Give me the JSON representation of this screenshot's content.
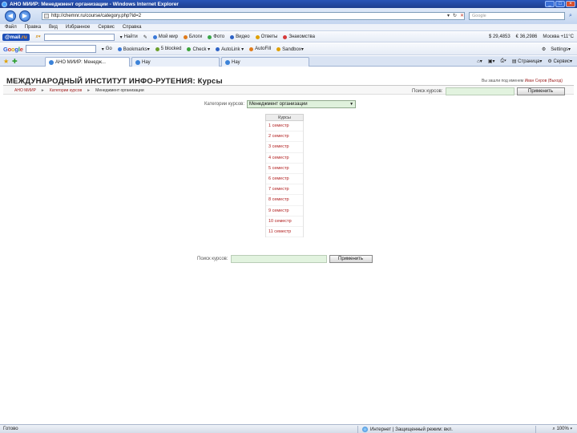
{
  "window": {
    "title": "АНО МИИР: Менеджмент организации - Windows Internet Explorer"
  },
  "address": {
    "url": "http://chemnr.ru/course/category.php?id=2",
    "search_placeholder": "Google"
  },
  "menu": [
    "Файл",
    "Правка",
    "Вид",
    "Избранное",
    "Сервис",
    "Справка"
  ],
  "mailbar": {
    "logo_prefix": "@",
    "logo_text": "mail",
    "logo_suffix": ".ru",
    "find": "Найти",
    "items": [
      "Мой мир",
      "Блоги",
      "Фото",
      "Видео",
      "Ответы",
      "Знакомства"
    ],
    "usd": "$ 29,4853",
    "eur": "€ 36,2986",
    "weather": "Москва +11°C"
  },
  "googlebar": {
    "logo": [
      "G",
      "o",
      "o",
      "g",
      "l",
      "e"
    ],
    "go": "Go",
    "items": [
      "Bookmarks▾",
      "5 blocked",
      "Check ▾",
      "AutoLink ▾",
      "AutoFill",
      "Sandbox▾"
    ],
    "settings": "Settings▾"
  },
  "tabs": {
    "items": [
      "АНО МИИР: Менедж...",
      "Нау",
      "Нау"
    ],
    "page": "Страница",
    "tools": "Сервис"
  },
  "site": {
    "title": "МЕЖДУНАРОДНЫЙ ИНСТИТУТ ИНФО-РУТЕНИЯ: Курсы",
    "login_prefix": "Вы зашли под именем",
    "login_user": "Иван Серов",
    "login_exit": "(Выход)"
  },
  "breadcrumbs": {
    "home": "АНО МИИР",
    "categories": "Категории курсов",
    "current": "Менеджмент организации",
    "sep": "►"
  },
  "search": {
    "label": "Поиск курсов:",
    "button": "Применить"
  },
  "category": {
    "label": "Категории курсов:",
    "selected": "Менеджмент организации"
  },
  "courses": {
    "header": "Курсы",
    "items": [
      "1 семестр",
      "2 семестр",
      "3 семестр",
      "4 семестр",
      "5 семестр",
      "6 семестр",
      "7 семестр",
      "8 семестр",
      "9 семестр",
      "10 семестр",
      "11 семестр"
    ]
  },
  "status": {
    "done": "Готово",
    "zone": "Интернет | Защищенный режим: вкл.",
    "zoom": "100%"
  }
}
